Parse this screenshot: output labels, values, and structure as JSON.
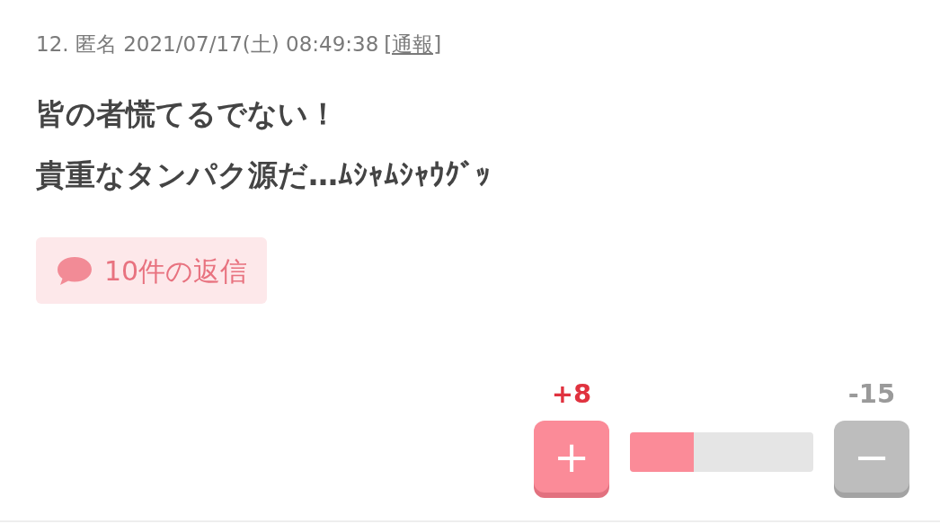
{
  "comment": {
    "header": "12. 匿名 2021/07/17(土) 08:49:38",
    "report_link": "[通報]",
    "body_lines": [
      "皆の者慌てるでない！",
      "貴重なタンパク源だ…ﾑｼｬﾑｼｬｳｸﾞｯ"
    ],
    "replies_button": "10件の返信"
  },
  "votes": {
    "plus": {
      "count": "+8",
      "symbol": "+"
    },
    "minus": {
      "count": "-15",
      "symbol": "−"
    },
    "level": 0.35
  }
}
